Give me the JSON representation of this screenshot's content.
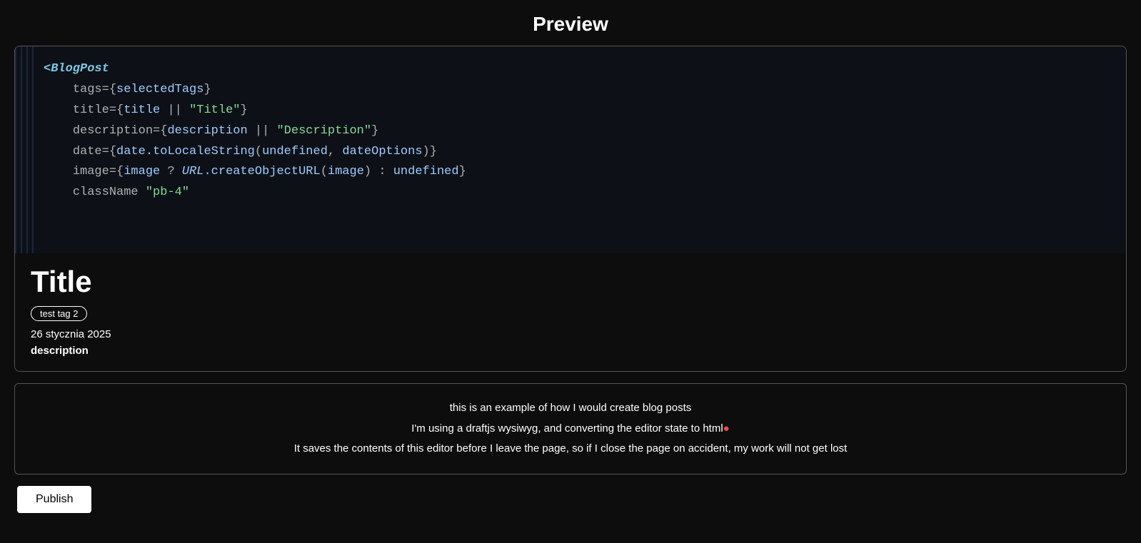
{
  "header": {
    "title": "Preview"
  },
  "code_block": {
    "tag_name": "<BlogPost",
    "lines": [
      {
        "attr": "tags",
        "value": "={selectedTags}"
      },
      {
        "attr": "title",
        "value": "={title || ",
        "string": "\"Title\"",
        "close": "}"
      },
      {
        "attr": "description",
        "value": "={description || ",
        "string": "\"Description\"",
        "close": "}"
      },
      {
        "attr": "date",
        "value": "={date.toLocaleString(undefined, dateOptions)}"
      },
      {
        "attr": "image",
        "value": "={image ? URL.createObjectURL(image) : undefined}"
      },
      {
        "attr": "className",
        "value": "\"pb-4\""
      }
    ]
  },
  "post_info": {
    "title": "Title",
    "tag": "test tag 2",
    "date": "26 stycznia 2025",
    "description": "description"
  },
  "editor": {
    "lines": [
      "this is an example of how I would create blog posts",
      "I'm using a draftjs wysiwyg, and converting the editor state to html",
      "It saves the contents of this editor before I leave the page, so if I close the page on accident, my work will not get lost"
    ]
  },
  "buttons": {
    "publish": "Publish"
  }
}
